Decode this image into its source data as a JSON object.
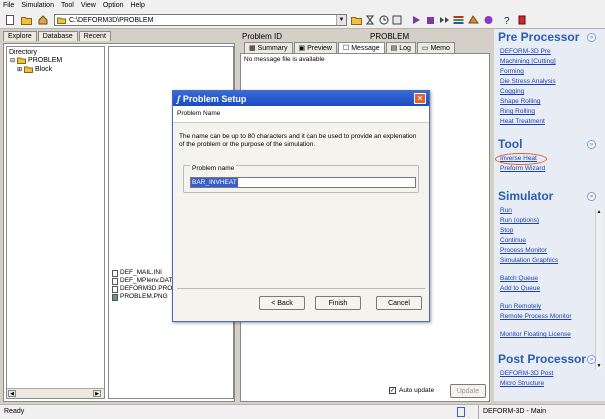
{
  "menu": [
    "File",
    "Simulation",
    "Tool",
    "View",
    "Option",
    "Help"
  ],
  "toolbar": {
    "path": "C:\\DEFORM3D\\PROBLEM"
  },
  "left_panel": {
    "tabs": [
      "Explore",
      "Database",
      "Recent"
    ],
    "tree_header": "Directory",
    "tree": [
      {
        "label": "PROBLEM"
      },
      {
        "label": "Block"
      }
    ],
    "files": [
      "DEF_MAIL.INI",
      "DEF_MPIenv.DAT",
      "DEFORM3D.PRO",
      "PROBLEM.PNG"
    ]
  },
  "center_panel": {
    "problem_id_label": "Problem ID",
    "problem_id_value": "PROBLEM",
    "tabs": [
      "Summary",
      "Preview",
      "Message",
      "Log",
      "Memo"
    ],
    "active_tab": "Message",
    "message": "No message file is available",
    "auto_update_label": "Auto update",
    "auto_update_checked": true,
    "update_button": "Update"
  },
  "right_panel": {
    "sections": [
      {
        "title": "Pre Processor",
        "links": [
          "DEFORM-3D Pre",
          "Machining [Cutting]",
          "Forming",
          "Die Stress Analysis",
          "Cogging",
          "Shape Rolling",
          "Ring Rolling",
          "Heat Treatment"
        ]
      },
      {
        "title": "Tool",
        "links": [
          "Inverse Heat",
          "Preform Wizard"
        ]
      },
      {
        "title": "Simulator",
        "links": [
          "Run",
          "Run (options)",
          "Stop",
          "Continue",
          "Process Monitor",
          "Simulation Graphics",
          "Batch Queue",
          "Add to Queue",
          "Run Remotely",
          "Remote Process Monitor",
          "Monitor Floating License"
        ]
      },
      {
        "title": "Post Processor",
        "links": [
          "DEFORM-3D Post",
          "Micro Structure"
        ]
      }
    ]
  },
  "dialog": {
    "title": "Problem Setup",
    "subtitle": "Problem Name",
    "description": "The name can be up to 80 characters and it can be used to provide an explenation of the problem or the purpose of the simulation.",
    "field_label": "Problem name",
    "field_value": "BAR_INVHEAT",
    "back_button": "< Back",
    "finish_button": "Finish",
    "cancel_button": "Cancel"
  },
  "status": {
    "left": "Ready",
    "right": "DEFORM-3D - Main"
  },
  "colors": {
    "section_title": "#2a5db0",
    "link": "#1d3fb8",
    "dialog_title_bar": "#1b4cc0",
    "highlight_circle": "#e0602a"
  }
}
